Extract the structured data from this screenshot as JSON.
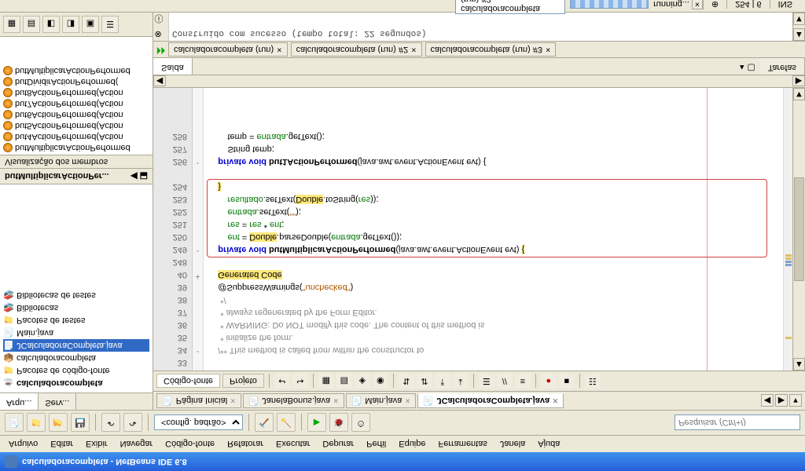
{
  "titlebar": {
    "title": "calculadoracompleta - NetBeans IDE 6.8"
  },
  "menubar": {
    "items": [
      "Arquivo",
      "Editar",
      "Exibir",
      "Navegar",
      "Código-fonte",
      "Refatorar",
      "Executar",
      "Depurar",
      "Perfil",
      "Equipe",
      "Ferramentas",
      "Janela",
      "Ajuda"
    ]
  },
  "toolbar": {
    "config_label": "<config. padrão>",
    "search_placeholder": "Pesquisar (Ctrl+I)"
  },
  "left_tabs": {
    "items": [
      "Arqu...",
      "Serv..."
    ],
    "active": 0
  },
  "project_tree": {
    "root": "calculadoracompleta",
    "nodes": [
      {
        "label": "Pacotes de código-fonte",
        "ind": 1,
        "icon": "folder"
      },
      {
        "label": "calculadoracompleta",
        "ind": 2,
        "icon": "package"
      },
      {
        "label": "JCalculadoraCompleta.java",
        "ind": 3,
        "icon": "java-file",
        "sel": true
      },
      {
        "label": "Main.java",
        "ind": 3,
        "icon": "java-file"
      },
      {
        "label": "Pacotes de testes",
        "ind": 1,
        "icon": "folder"
      },
      {
        "label": "Bibliotecas",
        "ind": 1,
        "icon": "libs"
      },
      {
        "label": "Bibliotecas de testes",
        "ind": 1,
        "icon": "libs"
      }
    ]
  },
  "navigator": {
    "title": "butMultiplicarActionPer...",
    "sub": "Visualização dos membros",
    "items": [
      "butMultiplicarActionPerformed",
      "but4ActionPerformed(Action",
      "but5ActionPerformed(Action",
      "but6ActionPerformed(Action",
      "but7ActionPerformed(Action",
      "but8ActionPerformed(Action",
      "butDividirActionPerformed(",
      "butMultiplicarActionPerformed"
    ]
  },
  "file_tabs": {
    "items": [
      {
        "label": "Página Inicial"
      },
      {
        "label": "JanelaBonus.java"
      },
      {
        "label": "Main.java"
      },
      {
        "label": "JCalculadoraCompleta.java",
        "active": true
      }
    ]
  },
  "editor_tabs": {
    "source": "Código-fonte",
    "project": "Projeto"
  },
  "code": {
    "lines": [
      {
        "n": 33,
        "text": ""
      },
      {
        "n": 34,
        "text": "    /** This method is called from within the constructor to",
        "cls": "com",
        "fold": "-"
      },
      {
        "n": 35,
        "text": "     * initialize the form.",
        "cls": "com"
      },
      {
        "n": 36,
        "text": "     * WARNING: Do NOT modify this code. The content of this method is",
        "cls": "com"
      },
      {
        "n": 37,
        "text": "     * always regenerated by the Form Editor.",
        "cls": "com"
      },
      {
        "n": 38,
        "text": "     */",
        "cls": "com"
      },
      {
        "n": 39,
        "html": "    @SuppressWarnings(<span class='str'>\"unchecked\"</span>)"
      },
      {
        "n": 40,
        "html": "    <span class='hl'>Generated Code</span>",
        "fold": "+"
      },
      {
        "n": 248,
        "text": ""
      },
      {
        "n": 249,
        "html": "    <span class='kw'>private void</span> <b>butMultiplicarActionPerformed</b>(java.awt.event.ActionEvent evt) <span class='hl'>{</span>",
        "fold": "-",
        "box_start": true
      },
      {
        "n": 250,
        "html": "        <span class='field'>ent</span> = <span class='hl'>Double</span>.parseDouble(<span class='field'>entrada</span>.getText());"
      },
      {
        "n": 251,
        "html": "        <span class='field'>res</span> = <span class='field'>res</span> * <span class='field'>ent</span>;"
      },
      {
        "n": 252,
        "html": "        <span class='field'>entrada</span>.setText(<span class='str'>\"\"</span>);"
      },
      {
        "n": 253,
        "html": "        <span class='field'>resultado</span>.setText(<span class='hl'>Double</span>.toString(<span class='field'>res</span>));"
      },
      {
        "n": 254,
        "html": "    <span class='hl'>}</span>",
        "box_end": true
      },
      {
        "n": "",
        "text": ""
      },
      {
        "n": 256,
        "html": "    <span class='kw'>private void</span> <b>but1ActionPerformed</b>(java.awt.event.ActionEvent evt) {",
        "fold": "-"
      },
      {
        "n": 257,
        "html": "        String temp;"
      },
      {
        "n": 258,
        "html": "        temp = <span class='field'>entrada</span>.getText();"
      }
    ]
  },
  "output": {
    "tabs": {
      "saida": "Saída",
      "tarefas": "Tarefas"
    },
    "runs": [
      {
        "label": "calculadoracompleta (run)"
      },
      {
        "label": "calculadoracompleta (run) #2",
        "active": true
      },
      {
        "label": "calculadoracompleta (run) #3"
      }
    ],
    "text": "Construído com sucesso (tempo total: 22 segundos)"
  },
  "statusbar": {
    "task": "calculadoracompleta (run) #2",
    "running": "running...",
    "pos": "254 | 6",
    "ins": "INS"
  }
}
